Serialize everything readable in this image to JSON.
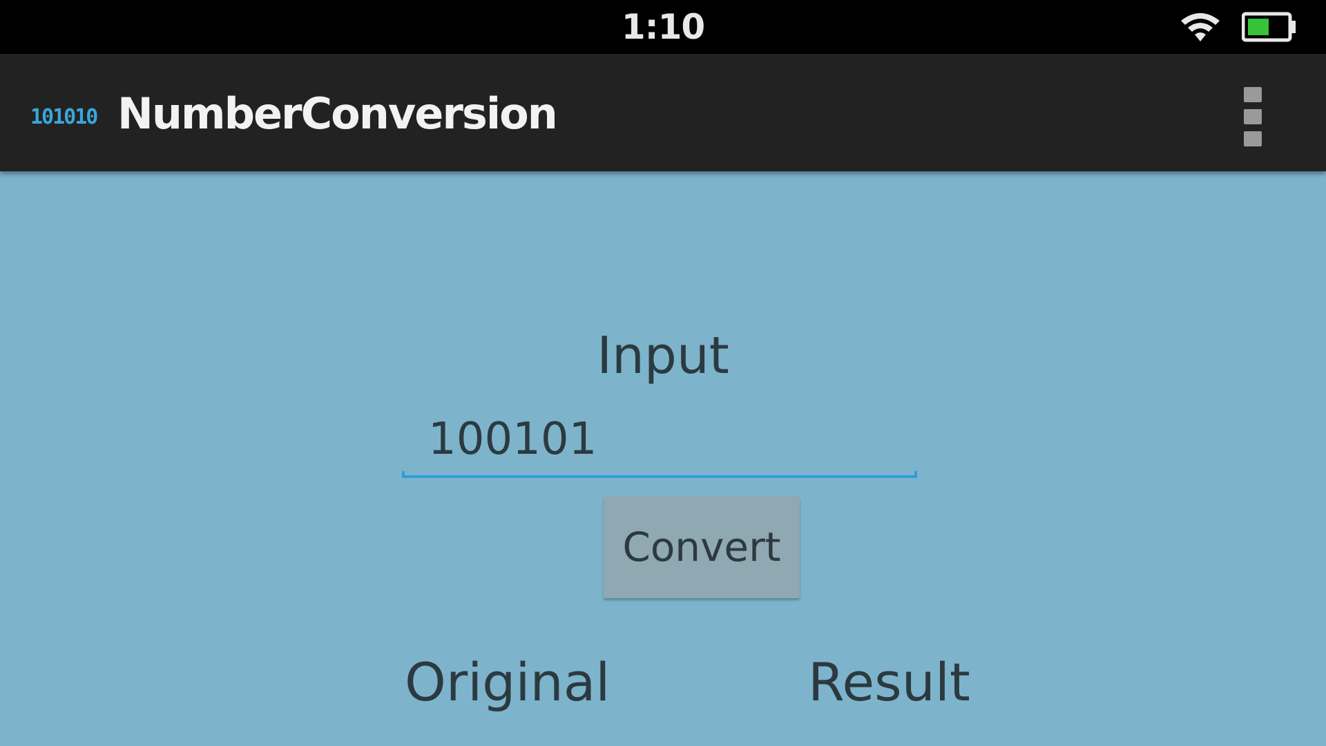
{
  "status_bar": {
    "time": "1:10",
    "wifi_icon": "wifi-icon",
    "battery_icon": "battery-icon",
    "battery_color": "#38c23a"
  },
  "action_bar": {
    "app_icon_text": "101010",
    "app_icon_color": "#3aa6d9",
    "title": "NumberConversion",
    "overflow_icon": "overflow-menu-icon"
  },
  "main": {
    "input_label": "Input",
    "input_value": "100101",
    "accent_color": "#2f9fd6",
    "convert_label": "Convert",
    "original_label": "Original",
    "result_label": "Result"
  },
  "colors": {
    "background": "#7db4cc",
    "action_bar": "#222222",
    "status_bar": "#000000",
    "text": "#2c3a40"
  }
}
